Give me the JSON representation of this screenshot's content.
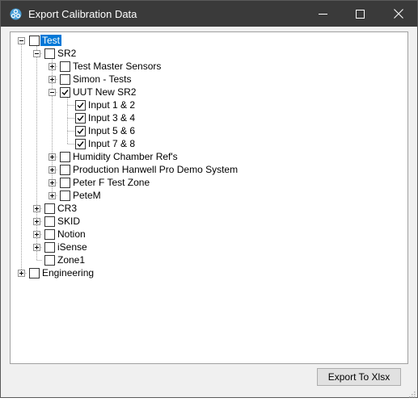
{
  "window": {
    "title": "Export Calibration Data",
    "app_icon": "gear-cluster-icon",
    "controls": [
      "minimize-icon",
      "maximize-icon",
      "close-icon"
    ]
  },
  "tree": {
    "nodes": [
      {
        "label": "Test",
        "checked": false,
        "expanded": true,
        "selected": true
      },
      {
        "label": "SR2",
        "checked": false,
        "expanded": true
      },
      {
        "label": "Test Master Sensors",
        "checked": false,
        "expanded": false
      },
      {
        "label": "Simon - Tests",
        "checked": false,
        "expanded": false
      },
      {
        "label": "UUT New SR2",
        "checked": true,
        "expanded": true
      },
      {
        "label": "Input 1 & 2",
        "checked": true
      },
      {
        "label": "Input 3 & 4",
        "checked": true
      },
      {
        "label": "Input 5 & 6",
        "checked": true
      },
      {
        "label": "Input 7 & 8",
        "checked": true
      },
      {
        "label": "Humidity Chamber Ref's",
        "checked": false,
        "expanded": false
      },
      {
        "label": "Production Hanwell Pro Demo System",
        "checked": false,
        "expanded": false
      },
      {
        "label": "Peter F Test Zone",
        "checked": false,
        "expanded": false
      },
      {
        "label": "PeteM",
        "checked": false,
        "expanded": false
      },
      {
        "label": "CR3",
        "checked": false,
        "expanded": false
      },
      {
        "label": "SKID",
        "checked": false,
        "expanded": false
      },
      {
        "label": "Notion",
        "checked": false,
        "expanded": false
      },
      {
        "label": "iSense",
        "checked": false,
        "expanded": false
      },
      {
        "label": "Zone1",
        "checked": false
      },
      {
        "label": "Engineering",
        "checked": false,
        "expanded": false
      }
    ]
  },
  "footer": {
    "export_label": "Export To Xlsx"
  },
  "colors": {
    "titlebar": "#3a3a3a",
    "selection": "#0078d7"
  }
}
